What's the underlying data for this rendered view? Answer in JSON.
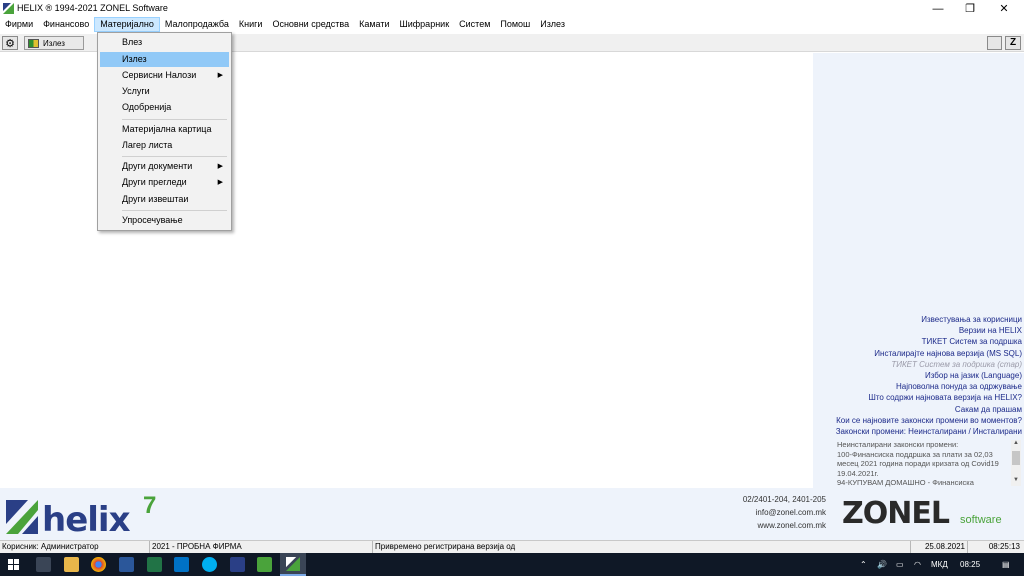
{
  "window": {
    "title": "HELIX ® 1994-2021   ZONEL Software",
    "minimize": "—",
    "maximize": "❐",
    "close": "✕"
  },
  "menubar": {
    "items": [
      "Фирми",
      "Финансово",
      "Материјално",
      "Малопродажба",
      "Книги",
      "Основни средства",
      "Камати",
      "Шифрарник",
      "Систем",
      "Помош",
      "Излез"
    ],
    "active": "Материјално"
  },
  "toolbar": {
    "exit_label": "Излез",
    "z_label": "Z"
  },
  "dropdown": {
    "items": [
      {
        "label": "Влез"
      },
      {
        "label": "Излез",
        "highlighted": true
      },
      {
        "label": "Сервисни Налози",
        "submenu": true
      },
      {
        "label": "Услуги"
      },
      {
        "label": "Одобренија"
      },
      {
        "label": "Материјална картица"
      },
      {
        "label": "Лагер листа"
      },
      {
        "label": "Други документи",
        "submenu": true
      },
      {
        "label": "Други прегледи",
        "submenu": true
      },
      {
        "label": "Други извештаи"
      },
      {
        "label": "Упросечување"
      }
    ]
  },
  "links": [
    {
      "text": "Известувања за корисници"
    },
    {
      "text": "Верзии на HELIX"
    },
    {
      "text": "ТИКЕТ Систем за подршка"
    },
    {
      "text": "Инсталирајте најнова верзија (MS SQL)"
    },
    {
      "text": "ТИКЕТ Систем за подршка (стар)",
      "disabled": true
    },
    {
      "text": "Избор на јазик (Language)"
    },
    {
      "text": "Најповолна понуда за одржување"
    },
    {
      "text": "Што содржи најновата верзија на HELIX?"
    },
    {
      "text": "Сакам да прашам"
    },
    {
      "text": "Кои се најновите законски промени во моментов?"
    },
    {
      "text": "Законски промени:  Неинсталирани / Инсталирани"
    }
  ],
  "news": {
    "line1": "Неинсталирани законски промени:",
    "line2": "100-Финансиска поддршка за плати за 02,03 месец 2021 година поради кризата од Covid19 19.04.2021г.",
    "line3": "94-КУПУВАМ ДОМАШНО - Финансиска"
  },
  "footer": {
    "logo_text": "helix",
    "logo_version": "7",
    "phone": "02/2401-204, 2401-205",
    "email": "info@zonel.com.mk",
    "web": "www.zonel.com.mk",
    "brand": "ZONEL",
    "brand_suffix": "software"
  },
  "status": {
    "user": "Корисник: Администратор",
    "company": "2021 - ПРОБНА ФИРМА",
    "license": "Привремено регистрирана верзија од",
    "date": "25.08.2021",
    "time": "08:25:13"
  },
  "taskbar": {
    "language": "МКД",
    "clock": "08:25"
  },
  "colors": {
    "link": "#1c2a8a",
    "helix_blue": "#2a3f86",
    "helix_green": "#4aa33b",
    "panel_bg": "#eef3fb",
    "menu_highlight": "#91c9f7"
  }
}
